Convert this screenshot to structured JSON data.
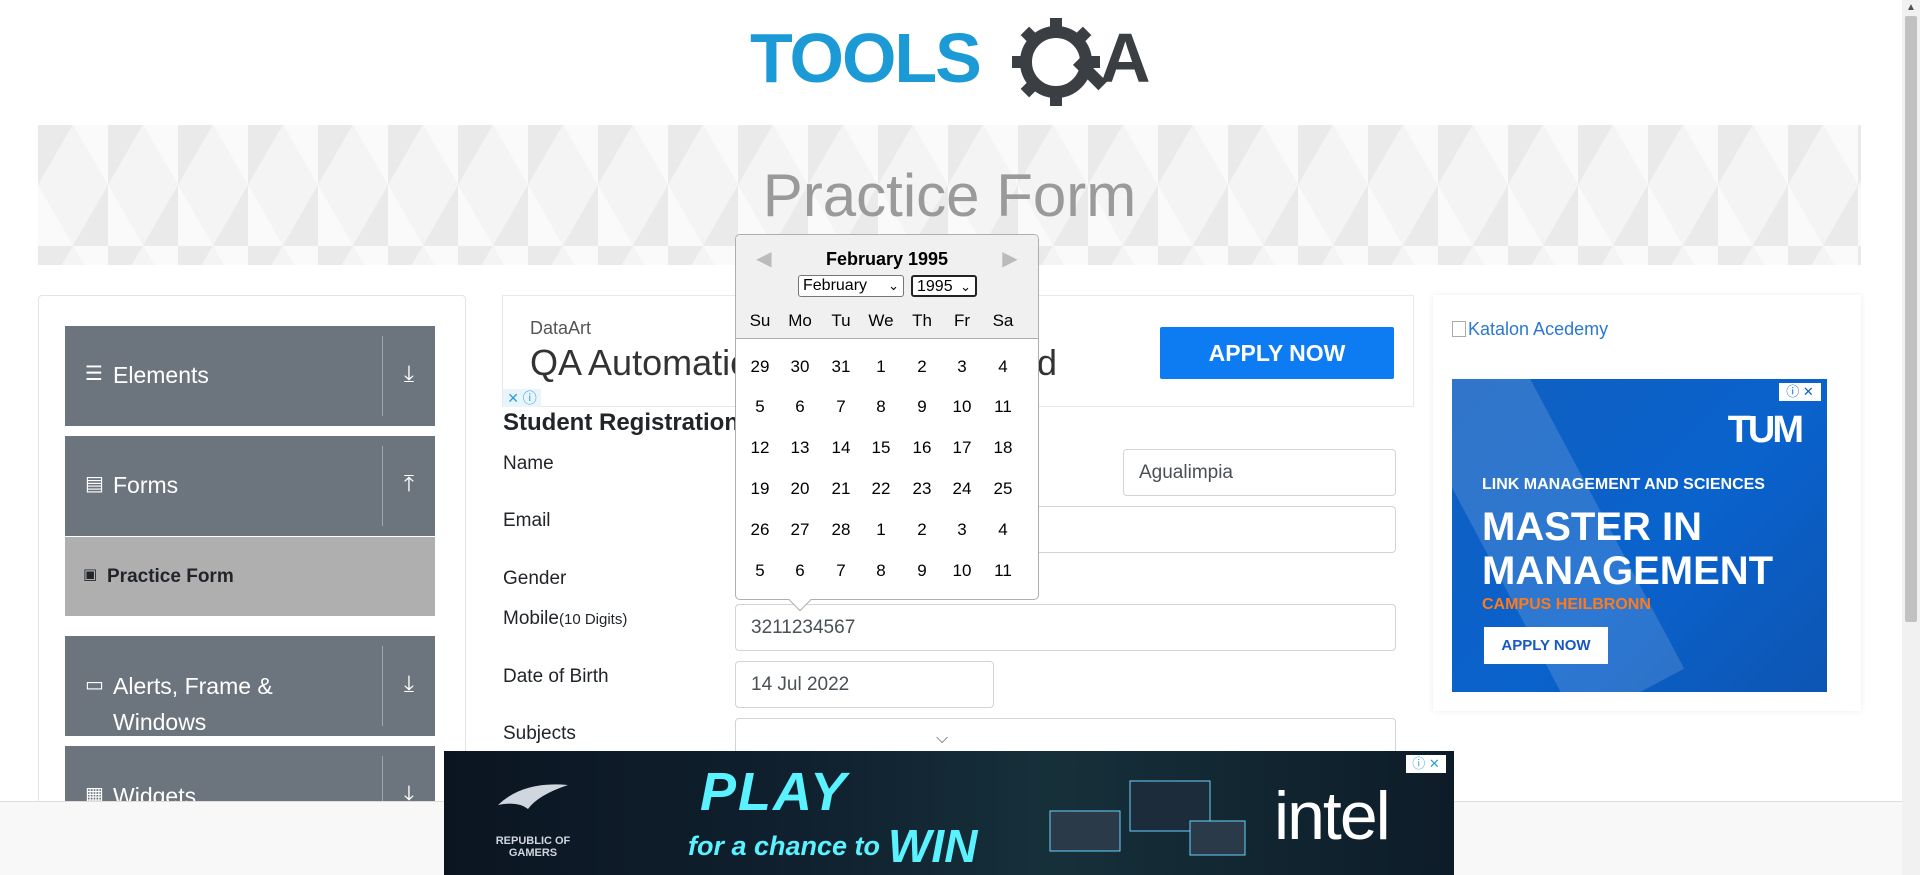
{
  "header": {
    "logo_text": "TOOLSQA"
  },
  "banner": {
    "title": "Practice Form"
  },
  "sidebar": {
    "groups": [
      {
        "label": "Elements",
        "arrow": "⤓"
      },
      {
        "label": "Forms",
        "arrow": "⤒"
      },
      {
        "label": "Alerts, Frame & Windows",
        "arrow": "⤓"
      },
      {
        "label": "Widgets",
        "arrow": "⤓"
      }
    ],
    "active_item": "Practice Form"
  },
  "ad_top": {
    "brand": "DataArt",
    "headline": "QA Automation Engineer Wanted",
    "cta": "APPLY NOW"
  },
  "form": {
    "title": "Student Registration Form",
    "name_label": "Name",
    "last_name_value": "Agualimpia",
    "email_label": "Email",
    "gender_label": "Gender",
    "mobile_label": "Mobile",
    "mobile_hint": "(10 Digits)",
    "mobile_value": "3211234567",
    "dob_label": "Date of Birth",
    "dob_value": "14 Jul 2022",
    "subjects_label": "Subjects"
  },
  "datepicker": {
    "current_month": "February 1995",
    "month_select": "February",
    "year_select": "1995",
    "day_names": [
      "Su",
      "Mo",
      "Tu",
      "We",
      "Th",
      "Fr",
      "Sa"
    ],
    "weeks": [
      [
        "29",
        "30",
        "31",
        "1",
        "2",
        "3",
        "4"
      ],
      [
        "5",
        "6",
        "7",
        "8",
        "9",
        "10",
        "11"
      ],
      [
        "12",
        "13",
        "14",
        "15",
        "16",
        "17",
        "18"
      ],
      [
        "19",
        "20",
        "21",
        "22",
        "23",
        "24",
        "25"
      ],
      [
        "26",
        "27",
        "28",
        "1",
        "2",
        "3",
        "4"
      ],
      [
        "5",
        "6",
        "7",
        "8",
        "9",
        "10",
        "11"
      ]
    ]
  },
  "right_ad": {
    "broken_image_alt": "Katalon Acedemy",
    "logo": "TUM",
    "line1": "LINK MANAGEMENT AND SCIENCES",
    "big_line1": "MASTER IN",
    "big_line2": "MANAGEMENT",
    "campus": "CAMPUS HEILBRONN",
    "cta": "APPLY NOW"
  },
  "bottom_ad": {
    "rog_text": "REPUBLIC OF GAMERS",
    "play": "PLAY",
    "chance": "for a chance to",
    "win": "WIN",
    "brand": "intel"
  },
  "colors": {
    "sidebar_header": "#6c757d",
    "active_item": "#afafaf",
    "apply_button": "#0d7cf2",
    "tum_blue": "#0a62cc",
    "play_cyan": "#5bf2ff"
  }
}
